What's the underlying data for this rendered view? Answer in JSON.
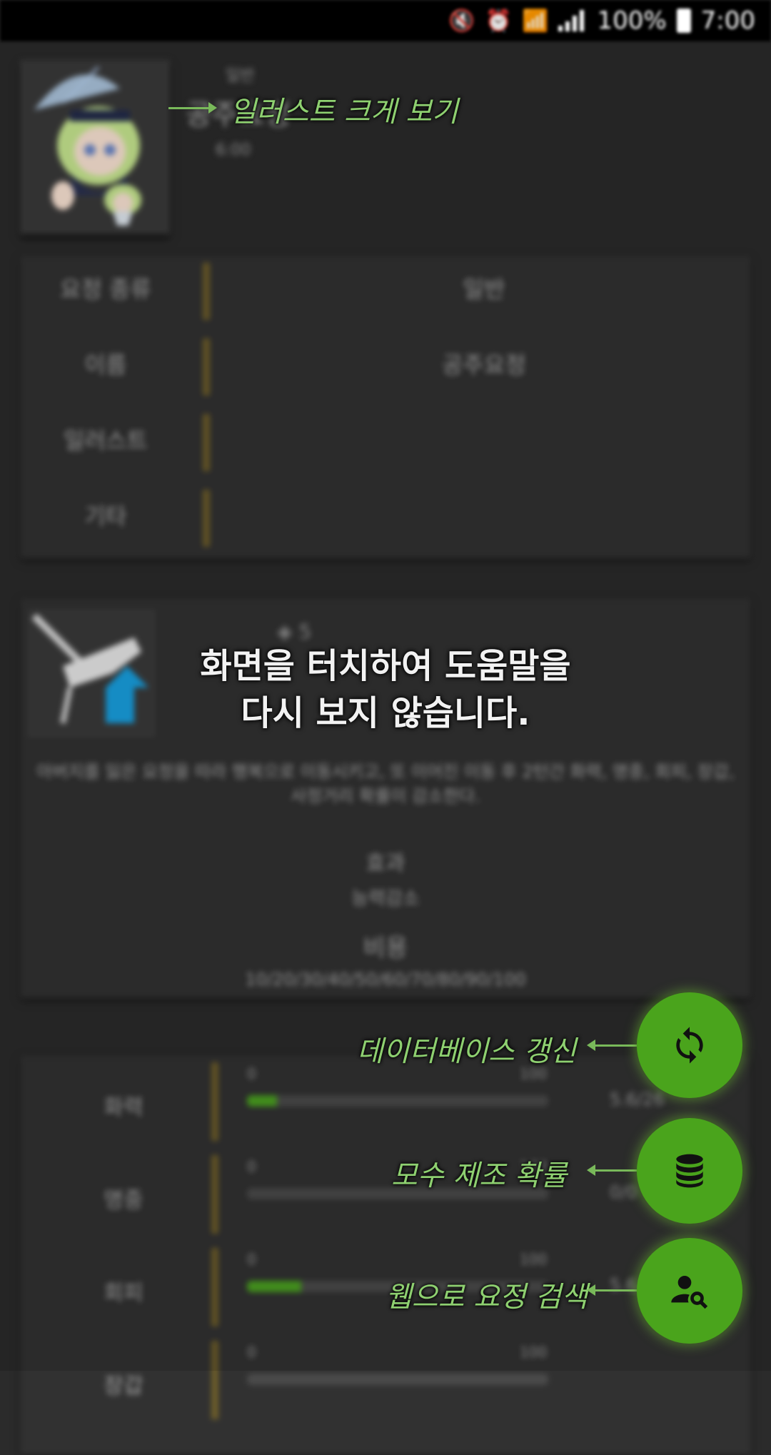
{
  "status_bar": {
    "battery": "100%",
    "time": "7:00"
  },
  "header": {
    "type": "일반",
    "name": "공주요정",
    "time": "6:00"
  },
  "info": {
    "rows": [
      {
        "label": "요정 종류",
        "value": "일반"
      },
      {
        "label": "이름",
        "value": "공주요정"
      },
      {
        "label": "일러스트",
        "value": ""
      },
      {
        "label": "기타",
        "value": ""
      }
    ]
  },
  "skill": {
    "side_num": "5",
    "description": "아버지를 잃은 요정을 따라 행복으로 이동시키고, 또 이어진 이동 후 2턴간 화력, 명중, 회피, 장갑, 사정거리 확률이 감소한다.",
    "label1": "효과",
    "label2": "능력감소",
    "label3": "비용",
    "label4": "10/20/30/40/50/60/70/80/90/100"
  },
  "stats": {
    "rows": [
      {
        "label": "화력",
        "min": "0",
        "max": "100",
        "fill": 0.1,
        "num": "5.6/26"
      },
      {
        "label": "명중",
        "min": "0",
        "max": "100",
        "fill": 0.0,
        "num": "0/0"
      },
      {
        "label": "회피",
        "min": "0",
        "max": "100",
        "fill": 0.18,
        "num": "5.6/26"
      },
      {
        "label": "장갑",
        "min": "0",
        "max": "100",
        "fill": 0.0,
        "num": ""
      }
    ]
  },
  "overlay": {
    "message_line1": "화면을 터치하여 도움말을",
    "message_line2": "다시 보지 않습니다.",
    "hint_illustration": "일러스트 크게 보기",
    "hint_update_db": "데이터베이스 갱신",
    "hint_production_rate": "모수 제조 확률",
    "hint_web_search": "웹으로 요정 검색"
  },
  "colors": {
    "accent": "#4aa41c",
    "hint": "#8ed070",
    "background": "#2b2b2b"
  },
  "icons": {
    "fab1": "sync-icon",
    "fab2": "database-icon",
    "fab3": "person-search-icon"
  }
}
